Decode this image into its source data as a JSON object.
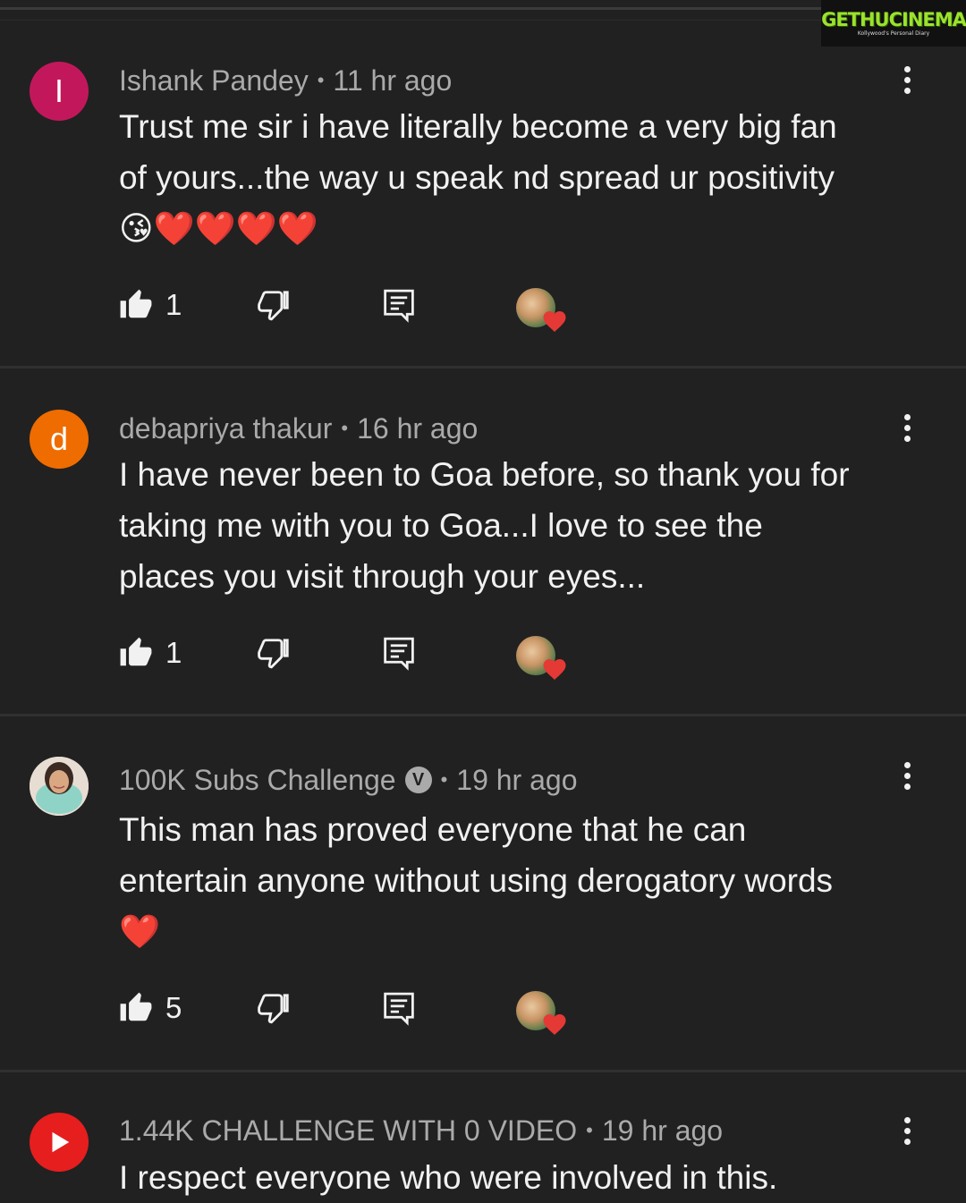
{
  "watermark": {
    "title": "GETHUCINEMA",
    "subtitle": "Kollywood's Personal Diary"
  },
  "comments": [
    {
      "avatar_letter": "I",
      "avatar_color": "#c2185b",
      "author": "Ishank Pandey",
      "time": "11 hr ago",
      "text_lines": [
        "Trust me sir i have literally become a very big fan",
        "of yours...the way u speak nd spread ur positivity"
      ],
      "emojis": "😘❤️❤️❤️❤️",
      "likes": "1"
    },
    {
      "avatar_letter": "d",
      "avatar_color": "#ef6c00",
      "author": "debapriya thakur",
      "time": "16 hr ago",
      "text_lines": [
        "I have never been to Goa before, so thank you for",
        "taking me with you to Goa...I love to see the",
        "places you visit through your eyes..."
      ],
      "likes": "1"
    },
    {
      "avatar_letter": "",
      "author": "100K Subs Challenge",
      "verified_label": "V",
      "time": "19 hr ago",
      "text_lines": [
        "This man has proved everyone that he can",
        "entertain anyone without using derogatory words"
      ],
      "emojis": "❤️",
      "likes": "5"
    },
    {
      "author": "1.44K CHALLENGE WITH 0 VIDEO",
      "time": "19 hr ago",
      "text_lines": [
        "I respect everyone who were involved in this."
      ]
    }
  ],
  "colors": {
    "background": "#212121",
    "meta": "#aaaaaa",
    "text": "#f1f1f1",
    "heart": "#e53935"
  },
  "icons": {
    "like": "thumbs-up-icon",
    "dislike": "thumbs-down-icon",
    "reply": "reply-icon",
    "menu": "more-vert-icon",
    "creator_heart": "creator-heart-icon"
  }
}
